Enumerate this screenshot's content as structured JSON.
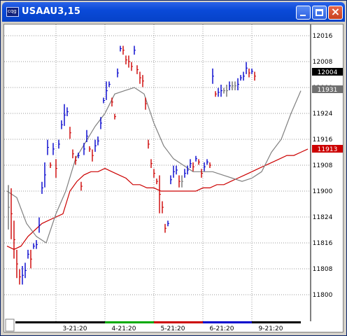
{
  "window": {
    "title": "USAAU3,15",
    "app_icon": "cqg-icon",
    "buttons": {
      "minimize": "minimize-icon",
      "maximize": "maximize-icon",
      "close": "close-icon"
    }
  },
  "colors": {
    "up_bars": "#0000cc",
    "down_bars": "#cc0000",
    "neutral_bars": "#707070",
    "ma_long": "#cc0000",
    "ma_short": "#808080",
    "last_price_bg": "#000000",
    "ma_short_bg": "#707070",
    "ma_long_bg": "#cc0000"
  },
  "price_axis": {
    "labels": [
      "12016",
      "12008",
      "12000",
      "11924",
      "11916",
      "11908",
      "11900",
      "11824",
      "11816",
      "11808",
      "11800"
    ]
  },
  "markers": {
    "last": "12004",
    "ma_short": "11931",
    "ma_long": "11913"
  },
  "time_axis": {
    "labels": [
      "3-21:20",
      "4-21:20",
      "5-21:20",
      "6-21:20",
      "9-21:20"
    ]
  },
  "chart_data": {
    "type": "bar",
    "title": "USAAU3,15",
    "price_labels": [
      "11800",
      "11808",
      "11816",
      "11824",
      "11900",
      "11908",
      "11916",
      "11924",
      "12000",
      "12008",
      "12016"
    ],
    "session_labels": [
      "3-21:20",
      "4-21:20",
      "5-21:20",
      "6-21:20",
      "9-21:20"
    ],
    "series": [
      {
        "values": [
          11821,
          11818,
          11812,
          11806,
          11804,
          11808,
          11806,
          11812,
          11809,
          11815,
          11815,
          11820,
          11832,
          11902,
          11915,
          11908,
          11912,
          11905,
          11915,
          11920,
          11921,
          11925,
          11919,
          11912,
          11909,
          11911,
          11901,
          11912,
          11918,
          11913,
          11910,
          11913,
          11915,
          11920,
          11928,
          11929,
          11933,
          11928,
          11923,
          12005,
          12012,
          12012,
          12008,
          12007,
          12006,
          12012,
          12006,
          12004,
          12003,
          11928,
          11915,
          11909,
          11906,
          11903,
          11904,
          11828,
          11821,
          11822,
          11903,
          11907,
          11907,
          11904,
          11902,
          11905,
          11906,
          11909,
          11908,
          11910,
          11909,
          11905,
          11907,
          11909,
          11908,
          12002,
          11930,
          11930,
          11930,
          11931,
          11930,
          11932,
          11933,
          12000,
          12000,
          12003,
          12003,
          12005,
          12005,
          12005,
          12004
        ]
      },
      {
        "values": [
          11833,
          11832,
          11822,
          11813,
          11807,
          11804,
          11809,
          11813,
          11813,
          11815,
          11816,
          11823,
          11834,
          11908,
          11912,
          11908,
          11914,
          11909,
          11914,
          11921,
          11926,
          11924,
          11917,
          11911,
          11910,
          11911,
          11902,
          11914,
          11916,
          11913,
          11912,
          11915,
          11916,
          11922,
          11928,
          11933,
          11933,
          11927,
          11923,
          12004,
          12012,
          12011,
          12009,
          12009,
          12007,
          12011,
          12005,
          12002,
          12001,
          11926,
          11914,
          11908,
          11905,
          11903,
          11826,
          11826,
          11820,
          11822,
          11904,
          11905,
          11906,
          11902,
          11904,
          11906,
          11907,
          11908,
          11907,
          11910,
          11909,
          11906,
          11908,
          11909,
          11908,
          12005,
          11930,
          11931,
          11932,
          11931,
          11932,
          11933,
          12000,
          12001,
          12002,
          12003,
          12004,
          12007,
          12004,
          12005,
          12003
        ]
      },
      {
        "values": [
          11815,
          11814,
          11815,
          11818,
          11820,
          11822,
          11823,
          11824,
          11825,
          11900,
          11903,
          11905,
          11906,
          11906,
          11907,
          11906,
          11905,
          11904,
          11902,
          11902,
          11901,
          11901,
          11900,
          11900,
          11900,
          11900,
          11900,
          11900,
          11901,
          11901,
          11902,
          11902,
          11903,
          11904,
          11905,
          11906,
          11907,
          11908,
          11909,
          11910,
          11911,
          11911,
          11912,
          11913
        ]
      },
      {
        "values": [
          11900,
          11830,
          11822,
          11818,
          11816,
          11825,
          11900,
          11910,
          11915,
          11920,
          11924,
          11930,
          11931,
          11932,
          11930,
          11921,
          11914,
          11910,
          11908,
          11906,
          11906,
          11906,
          11905,
          11904,
          11903,
          11904,
          11906,
          11912,
          11916,
          11924,
          11931
        ]
      }
    ]
  }
}
